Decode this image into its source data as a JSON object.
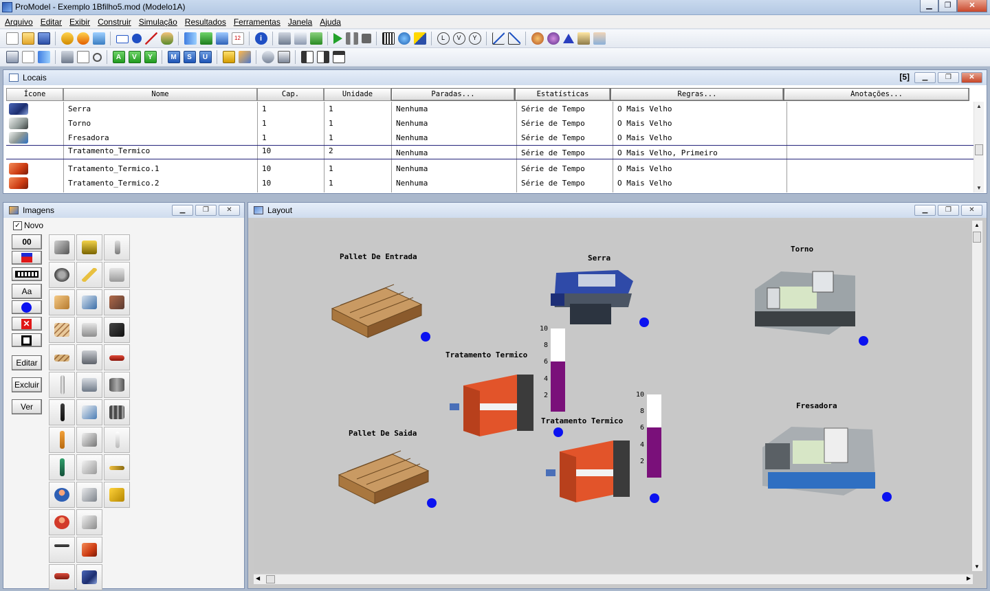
{
  "window": {
    "title": "ProModel - Exemplo 1Bfilho5.mod (Modelo1A)"
  },
  "menu": [
    "Arquivo",
    "Editar",
    "Exibir",
    "Construir",
    "Simulação",
    "Resultados",
    "Ferramentas",
    "Janela",
    "Ajuda"
  ],
  "toolbar2_letters": [
    "A",
    "V",
    "Y",
    "M",
    "S",
    "U"
  ],
  "locais": {
    "title": "Locais",
    "count": "[5]",
    "columns": [
      "Ícone",
      "Nome",
      "Cap.",
      "Unidade",
      "Paradas...",
      "Estatísticas",
      "Regras...",
      "Anotações..."
    ],
    "rows": [
      {
        "icon": "saw-machine-icon",
        "nome": "Serra",
        "cap": "1",
        "unidade": "1",
        "paradas": "Nenhuma",
        "estatisticas": "Série de Tempo",
        "regras": "O Mais Velho"
      },
      {
        "icon": "lathe-machine-icon",
        "nome": "Torno",
        "cap": "1",
        "unidade": "1",
        "paradas": "Nenhuma",
        "estatisticas": "Série de Tempo",
        "regras": "O Mais Velho"
      },
      {
        "icon": "milling-machine-icon",
        "nome": "Fresadora",
        "cap": "1",
        "unidade": "1",
        "paradas": "Nenhuma",
        "estatisticas": "Série de Tempo",
        "regras": "O Mais Velho"
      },
      {
        "icon": "",
        "nome": "Tratamento_Termico",
        "cap": "10",
        "unidade": "2",
        "paradas": "Nenhuma",
        "estatisticas": "Série de Tempo",
        "regras": "O Mais Velho, Primeiro"
      },
      {
        "icon": "press-brake-icon",
        "nome": "Tratamento_Termico.1",
        "cap": "10",
        "unidade": "1",
        "paradas": "Nenhuma",
        "estatisticas": "Série de Tempo",
        "regras": "O Mais Velho"
      },
      {
        "icon": "press-brake-icon",
        "nome": "Tratamento_Termico.2",
        "cap": "10",
        "unidade": "1",
        "paradas": "Nenhuma",
        "estatisticas": "Série de Tempo",
        "regras": "O Mais Velho"
      }
    ]
  },
  "imagens": {
    "title": "Imagens",
    "novo_label": "Novo",
    "novo_checked": true,
    "counter_label": "00",
    "text_tool_label": "Aa",
    "buttons": {
      "editar": "Editar",
      "excluir": "Excluir",
      "ver": "Ver"
    }
  },
  "layout": {
    "title": "Layout",
    "labels": {
      "pallet_entrada": "Pallet De Entrada",
      "serra": "Serra",
      "torno": "Torno",
      "tratamento1": "Tratamento Termico",
      "pallet_saida": "Pallet De Saida",
      "tratamento2": "Tratamento Termico",
      "fresadora": "Fresadora"
    },
    "gauge_ticks": [
      "10",
      "8",
      "6",
      "4",
      "2"
    ],
    "gauges": [
      {
        "name": "tratamento-termico-1-gauge",
        "level": 6,
        "max": 10
      },
      {
        "name": "tratamento-termico-2-gauge",
        "level": 6,
        "max": 10
      }
    ],
    "colors": {
      "indicator": "#0b12f0",
      "gauge_fill": "#7a107a"
    }
  }
}
